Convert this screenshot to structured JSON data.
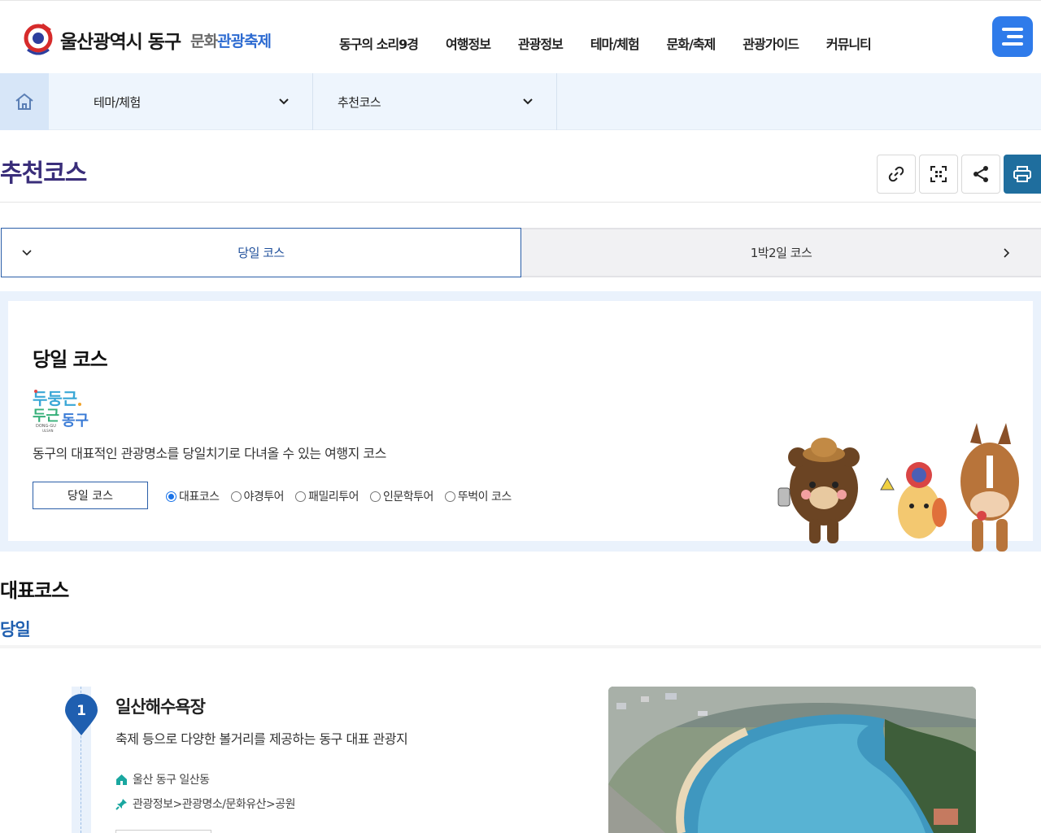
{
  "header": {
    "logo_main": "울산광역시 동구",
    "logo_sub_gray": "문화",
    "logo_sub_blue": "관광축제",
    "nav": [
      "동구의 소리9경",
      "여행정보",
      "관광정보",
      "테마/체험",
      "문화/축제",
      "관광가이드",
      "커뮤니티"
    ],
    "menu_icon": "hamburger-icon"
  },
  "location": {
    "home_icon": "home-icon",
    "depth1": "테마/체험",
    "depth2": "추천코스"
  },
  "page": {
    "title": "추천코스",
    "tools": [
      "link-icon",
      "qr-icon",
      "share-icon",
      "print-icon"
    ]
  },
  "tabs": {
    "active": "당일 코스",
    "inactive": "1박2일 코스"
  },
  "intro": {
    "title": "당일 코스",
    "description": "동구의 대표적인 관광명소를 당일치기로 다녀올 수 있는 여행지 코스",
    "button_label": "당일 코스",
    "radios": [
      {
        "label": "대표코스",
        "checked": true
      },
      {
        "label": "야경투어",
        "checked": false
      },
      {
        "label": "패밀리투어",
        "checked": false
      },
      {
        "label": "인문학투어",
        "checked": false
      },
      {
        "label": "뚜벅이 코스",
        "checked": false
      }
    ],
    "logo_text": "DONG-GU ULSAN"
  },
  "section": {
    "title": "대표코스",
    "subtitle": "당일"
  },
  "course_items": [
    {
      "number": "1",
      "title": "일산해수욕장",
      "description": "축제 등으로 다양한 볼거리를 제공하는 동구 대표 관광지",
      "address": "울산 동구 일산동",
      "category": "관광정보>관광명소/문화유산>공원"
    }
  ],
  "colors": {
    "brand_blue": "#2f7bea",
    "title_purple": "#3a2e7a",
    "accent_blue": "#1f5fb0",
    "print_button": "#1f6e9e"
  }
}
